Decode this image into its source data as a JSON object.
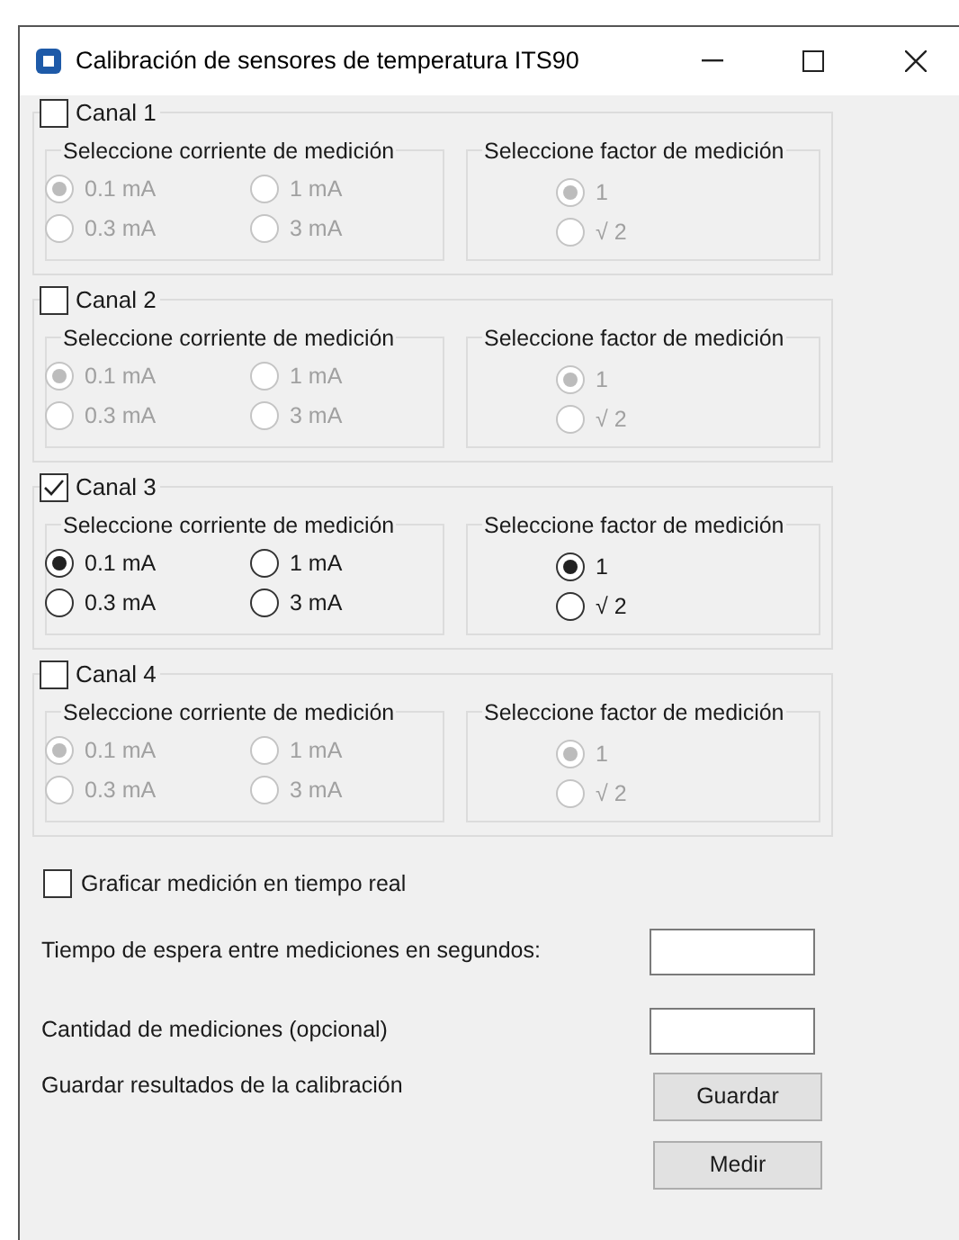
{
  "window": {
    "title": "Calibración de sensores de temperatura ITS90"
  },
  "channels": [
    {
      "label": "Canal 1",
      "checked": false,
      "disabled": true,
      "current": {
        "title": "Seleccione corriente de medición",
        "options": [
          {
            "label": "0.1 mA",
            "selected": true
          },
          {
            "label": "1 mA",
            "selected": false
          },
          {
            "label": "0.3 mA",
            "selected": false
          },
          {
            "label": "3 mA",
            "selected": false
          }
        ]
      },
      "factor": {
        "title": "Seleccione factor de medición",
        "options": [
          {
            "label": "1",
            "selected": true
          },
          {
            "label": "√ 2",
            "selected": false
          }
        ]
      }
    },
    {
      "label": "Canal 2",
      "checked": false,
      "disabled": true,
      "current": {
        "title": "Seleccione corriente de medición",
        "options": [
          {
            "label": "0.1 mA",
            "selected": true
          },
          {
            "label": "1 mA",
            "selected": false
          },
          {
            "label": "0.3 mA",
            "selected": false
          },
          {
            "label": "3 mA",
            "selected": false
          }
        ]
      },
      "factor": {
        "title": "Seleccione factor de medición",
        "options": [
          {
            "label": "1",
            "selected": true
          },
          {
            "label": "√ 2",
            "selected": false
          }
        ]
      }
    },
    {
      "label": "Canal 3",
      "checked": true,
      "disabled": false,
      "current": {
        "title": "Seleccione corriente de medición",
        "options": [
          {
            "label": "0.1 mA",
            "selected": true
          },
          {
            "label": "1 mA",
            "selected": false
          },
          {
            "label": "0.3 mA",
            "selected": false
          },
          {
            "label": "3 mA",
            "selected": false
          }
        ]
      },
      "factor": {
        "title": "Seleccione factor de medición",
        "options": [
          {
            "label": "1",
            "selected": true
          },
          {
            "label": "√ 2",
            "selected": false
          }
        ]
      }
    },
    {
      "label": "Canal 4",
      "checked": false,
      "disabled": true,
      "current": {
        "title": "Seleccione corriente de medición",
        "options": [
          {
            "label": "0.1 mA",
            "selected": true
          },
          {
            "label": "1 mA",
            "selected": false
          },
          {
            "label": "0.3 mA",
            "selected": false
          },
          {
            "label": "3 mA",
            "selected": false
          }
        ]
      },
      "factor": {
        "title": "Seleccione factor de medición",
        "options": [
          {
            "label": "1",
            "selected": true
          },
          {
            "label": "√ 2",
            "selected": false
          }
        ]
      }
    }
  ],
  "plot_checkbox": {
    "label": "Graficar medición en tiempo real",
    "checked": false
  },
  "fields": [
    {
      "label": "Tiempo de espera entre mediciones en segundos:"
    },
    {
      "label": "Cantidad de mediciones (opcional)"
    }
  ],
  "save": {
    "label": "Guardar resultados de la calibración",
    "button": "Guardar"
  },
  "measure_button": "Medir"
}
